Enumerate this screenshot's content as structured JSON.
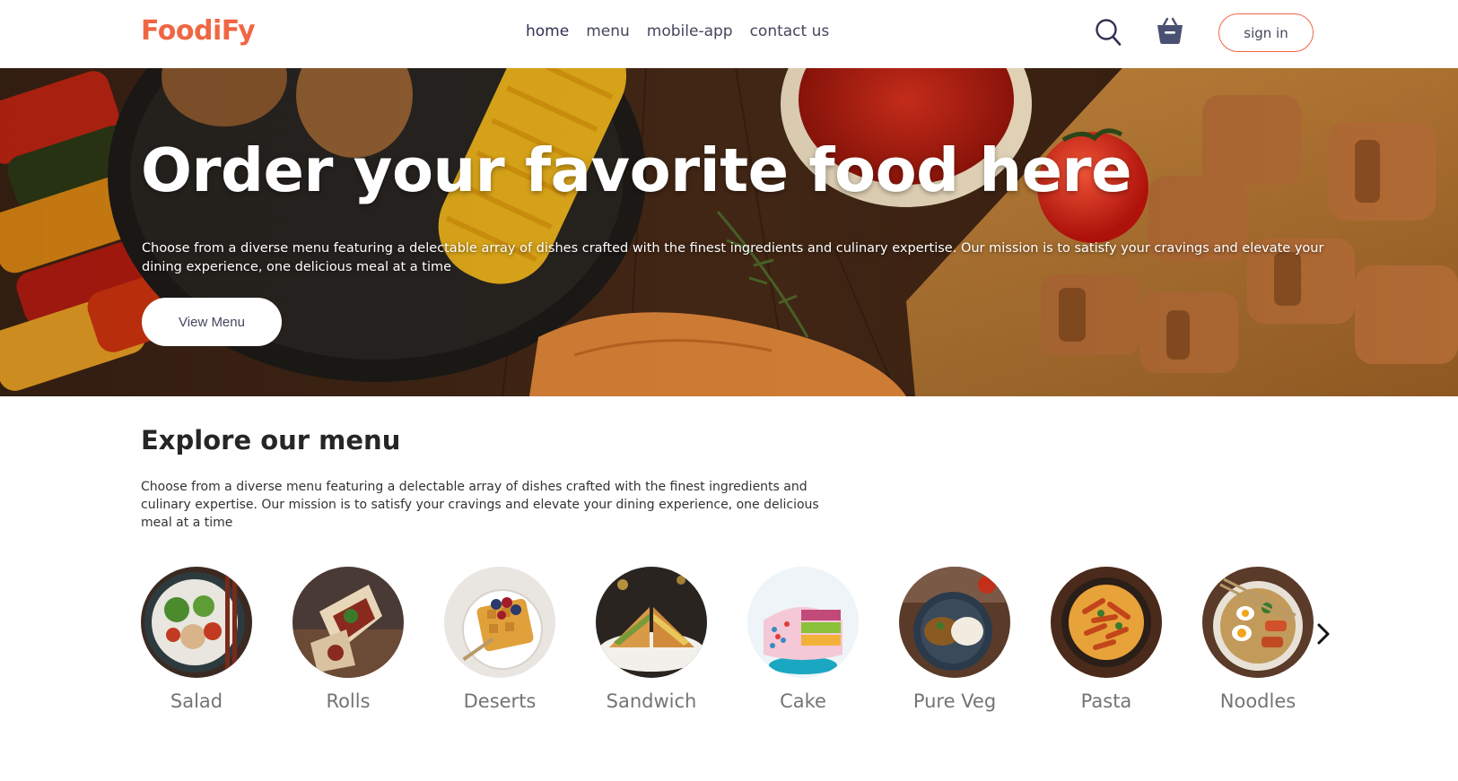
{
  "brand": {
    "logo_text": "FoodiFy",
    "accent_color": "#f06643"
  },
  "nav": {
    "links": [
      {
        "label": "home"
      },
      {
        "label": "menu"
      },
      {
        "label": "mobile-app"
      },
      {
        "label": "contact us"
      }
    ],
    "search_icon": "search-icon",
    "basket_icon": "basket-icon",
    "sign_in_label": "sign in"
  },
  "hero": {
    "title": "Order your favorite food here",
    "description": "Choose from a diverse menu featuring a delectable array of dishes crafted with the finest ingredients and culinary expertise. Our mission is to satisfy your cravings and elevate your dining experience, one delicious meal at a time",
    "button_label": "View Menu"
  },
  "explore": {
    "title": "Explore our menu",
    "description": "Choose from a diverse menu featuring a delectable array of dishes crafted with the finest ingredients and culinary expertise. Our mission is to satisfy your cravings and elevate your dining experience, one delicious meal at a time",
    "items": [
      {
        "label": "Salad"
      },
      {
        "label": "Rolls"
      },
      {
        "label": "Deserts"
      },
      {
        "label": "Sandwich"
      },
      {
        "label": "Cake"
      },
      {
        "label": "Pure Veg"
      },
      {
        "label": "Pasta"
      },
      {
        "label": "Noodles"
      }
    ],
    "next_icon": "chevron-right-icon"
  }
}
